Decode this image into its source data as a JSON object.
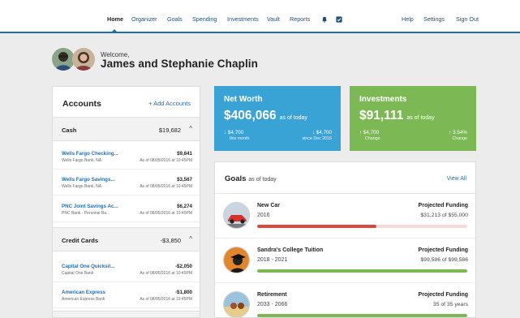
{
  "nav": {
    "items": [
      {
        "label": "Home",
        "active": true
      },
      {
        "label": "Organizer"
      },
      {
        "label": "Goals"
      },
      {
        "label": "Spending"
      },
      {
        "label": "Investments"
      },
      {
        "label": "Vault"
      },
      {
        "label": "Reports"
      }
    ],
    "icons": [
      "bell-icon",
      "checklist-icon"
    ],
    "right_items": [
      {
        "label": "Help"
      },
      {
        "label": "Settings"
      },
      {
        "label": "Sign Out"
      }
    ]
  },
  "welcome": {
    "greeting": "Welcome,",
    "name": "James and Stephanie Chaplin"
  },
  "accounts": {
    "title": "Accounts",
    "add_label": "+ Add Accounts",
    "groups": [
      {
        "label": "Cash",
        "total": "$19,682",
        "caret": "^",
        "rows": [
          {
            "name": "Wells Fargo Checking...",
            "institution": "Wells Fargo Bank, NA",
            "amount": "$9,841",
            "date": "As of 08/05/2016 at 10:45PM"
          },
          {
            "name": "Wells Fargo Savings...",
            "institution": "Wells Fargo Bank, NA",
            "amount": "$3,567",
            "date": "As of 08/05/2016 at 10:45PM"
          },
          {
            "name": "PNC Joint Savings Ac...",
            "institution": "PNC Bank - Personal Ba...",
            "amount": "$6,274",
            "date": "As of 08/05/2016 at 10:45PM"
          }
        ]
      },
      {
        "label": "Credit Cards",
        "total": "-$3,850",
        "caret": "^",
        "rows": [
          {
            "name": "Capital One Quicksil...",
            "institution": "Capital One Bank",
            "amount": "-$2,050",
            "date": "As of 08/05/2016 at 10:45PM"
          },
          {
            "name": "American Express",
            "institution": "American Express Bank",
            "amount": "-$1,800",
            "date": "As of 08/05/2016 at 10:45PM"
          }
        ]
      }
    ]
  },
  "net_worth": {
    "title": "Net Worth",
    "value": "$406,066",
    "as_of": "as of today",
    "left_change": "↓ $4,700",
    "left_caption": "this month",
    "right_change": "↓ $4,700",
    "right_caption": "since Dec 2016",
    "color": "#3aa3d5"
  },
  "investments": {
    "title": "Investments",
    "value": "$91,111",
    "as_of": "as of today",
    "left_change": "↑ $4,700",
    "left_caption": "Change",
    "right_change": "↑ 3.54%",
    "right_caption": "Change",
    "color": "#7cb955"
  },
  "goals": {
    "title": "Goals",
    "as_of": "as of today",
    "view_all": "View All",
    "items": [
      {
        "name": "New Car",
        "years": "2016",
        "projected_label": "Projected Funding",
        "projected_value": "$31,213 of $55,000",
        "progress": 0.567,
        "color": "#d64a3f",
        "track": "#f6dcd9",
        "icon": "car-icon"
      },
      {
        "name": "Sandra's College Tuition",
        "years": "2018 - 2021",
        "projected_label": "Projected Funding",
        "projected_value": "$99,586 of $99,586",
        "progress": 1.0,
        "color": "#7cb955",
        "track": "#e8e8e8",
        "icon": "graduate-icon"
      },
      {
        "name": "Retirement",
        "years": "2033 - 2066",
        "projected_label": "Projected Funding",
        "projected_value": "35 of 35 years",
        "progress": 1.0,
        "color": "#7cb955",
        "track": "#e8e8e8",
        "icon": "beach-icon"
      }
    ]
  }
}
